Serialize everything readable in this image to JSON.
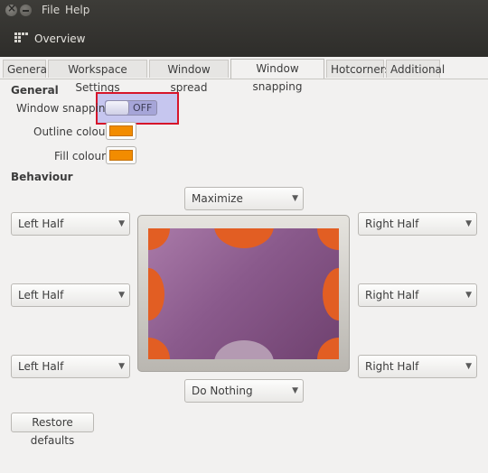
{
  "menu": {
    "file": "File",
    "help": "Help"
  },
  "toolbar": {
    "overview_label": "Overview"
  },
  "tabs": [
    {
      "label": "General"
    },
    {
      "label": "Workspace Settings"
    },
    {
      "label": "Window spread"
    },
    {
      "label": "Window snapping",
      "active": true
    },
    {
      "label": "Hotcorners"
    },
    {
      "label": "Additional"
    }
  ],
  "general": {
    "heading": "General",
    "snapping_label": "Window snapping:",
    "snapping_state": "OFF",
    "outline_label": "Outline colour:",
    "outline_color": "#f28c00",
    "fill_label": "Fill colour:",
    "fill_color": "#f28c00"
  },
  "behaviour": {
    "heading": "Behaviour",
    "top": "Maximize",
    "bottom": "Do Nothing",
    "left_top": "Left Half",
    "left_middle": "Left Half",
    "left_bottom": "Left Half",
    "right_top": "Right Half",
    "right_middle": "Right Half",
    "right_bottom": "Right Half"
  },
  "footer": {
    "restore_label": "Restore defaults"
  }
}
